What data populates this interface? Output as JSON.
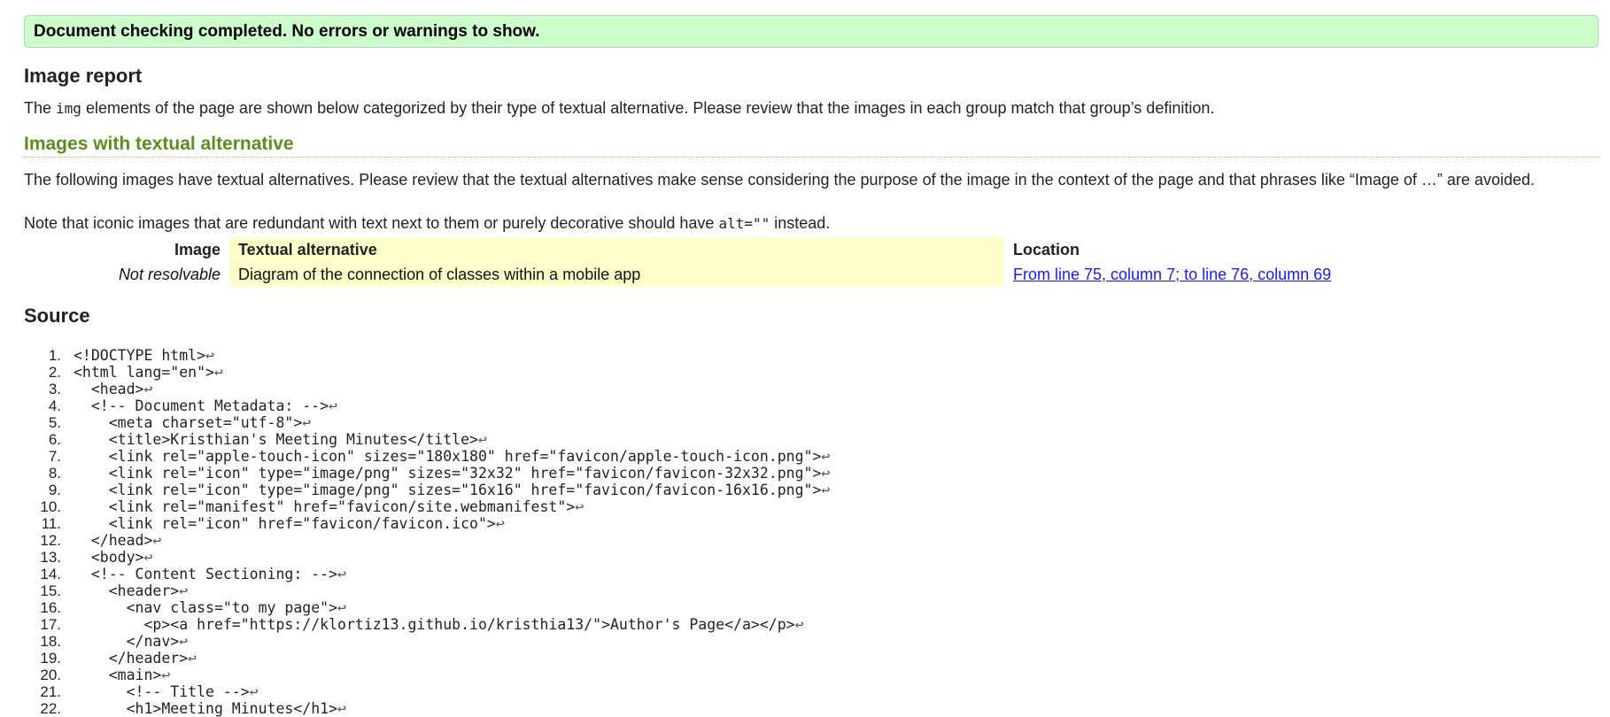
{
  "status": {
    "message": "Document checking completed. No errors or warnings to show."
  },
  "image_report": {
    "heading": "Image report",
    "intro_before": "The ",
    "intro_code": "img",
    "intro_after": " elements of the page are shown below categorized by their type of textual alternative. Please review that the images in each group match that group’s definition."
  },
  "alt_section": {
    "heading": "Images with textual alternative",
    "description": "The following images have textual alternatives. Please review that the textual alternatives make sense considering the purpose of the image in the context of the page and that phrases like “Image of …” are avoided.",
    "note_before": "Note that iconic images that are redundant with text next to them or purely decorative should have ",
    "note_code": "alt=\"\"",
    "note_after": " instead.",
    "table": {
      "headers": {
        "image": "Image",
        "alt": "Textual alternative",
        "location": "Location"
      },
      "rows": [
        {
          "image": "Not resolvable",
          "alt": "Diagram of the connection of classes within a mobile app",
          "location": "From line 75, column 7; to line 76, column 69"
        }
      ]
    }
  },
  "source": {
    "heading": "Source",
    "line_end_glyph": "↩",
    "lines": [
      {
        "n": "1.",
        "text": "<!DOCTYPE html>"
      },
      {
        "n": "2.",
        "text": "<html lang=\"en\">"
      },
      {
        "n": "3.",
        "text": "  <head>"
      },
      {
        "n": "4.",
        "text": "  <!-- Document Metadata: -->"
      },
      {
        "n": "5.",
        "text": "    <meta charset=\"utf-8\">"
      },
      {
        "n": "6.",
        "text": "    <title>Kristhian's Meeting Minutes</title>"
      },
      {
        "n": "7.",
        "text": "    <link rel=\"apple-touch-icon\" sizes=\"180x180\" href=\"favicon/apple-touch-icon.png\">"
      },
      {
        "n": "8.",
        "text": "    <link rel=\"icon\" type=\"image/png\" sizes=\"32x32\" href=\"favicon/favicon-32x32.png\">"
      },
      {
        "n": "9.",
        "text": "    <link rel=\"icon\" type=\"image/png\" sizes=\"16x16\" href=\"favicon/favicon-16x16.png\">"
      },
      {
        "n": "10.",
        "text": "    <link rel=\"manifest\" href=\"favicon/site.webmanifest\">"
      },
      {
        "n": "11.",
        "text": "    <link rel=\"icon\" href=\"favicon/favicon.ico\">"
      },
      {
        "n": "12.",
        "text": "  </head>"
      },
      {
        "n": "13.",
        "text": "  <body>"
      },
      {
        "n": "14.",
        "text": "  <!-- Content Sectioning: -->"
      },
      {
        "n": "15.",
        "text": "    <header>"
      },
      {
        "n": "16.",
        "text": "      <nav class=\"to my page\">"
      },
      {
        "n": "17.",
        "text": "        <p><a href=\"https://klortiz13.github.io/kristhia13/\">Author's Page</a></p>"
      },
      {
        "n": "18.",
        "text": "      </nav>"
      },
      {
        "n": "19.",
        "text": "    </header>"
      },
      {
        "n": "20.",
        "text": "    <main>"
      },
      {
        "n": "21.",
        "text": "      <!-- Title -->"
      },
      {
        "n": "22.",
        "text": "      <h1>Meeting Minutes</h1>"
      }
    ]
  }
}
